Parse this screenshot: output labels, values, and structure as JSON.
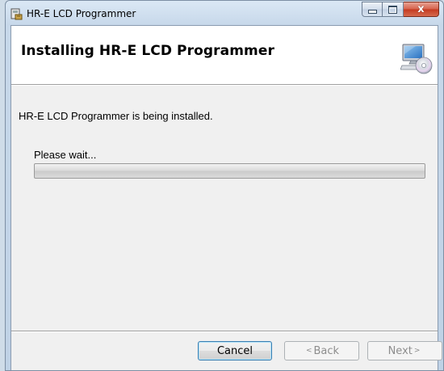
{
  "window": {
    "title": "HR-E LCD Programmer",
    "controls": {
      "minimize": "–",
      "maximize": "□",
      "close": "x"
    }
  },
  "header": {
    "title": "Installing HR-E LCD Programmer",
    "icon": "computer-cd-icon"
  },
  "body": {
    "status_text": "HR-E LCD Programmer is being installed.",
    "wait_label": "Please wait...",
    "progress_fraction": 0
  },
  "buttons": {
    "cancel": "Cancel",
    "back_label": "Back",
    "back_arrow": "<",
    "next_label": "Next",
    "next_arrow": ">"
  },
  "colors": {
    "progress_fill": "#06b025",
    "focus_border": "#3c7fb1",
    "close_button": "#c4391f"
  }
}
